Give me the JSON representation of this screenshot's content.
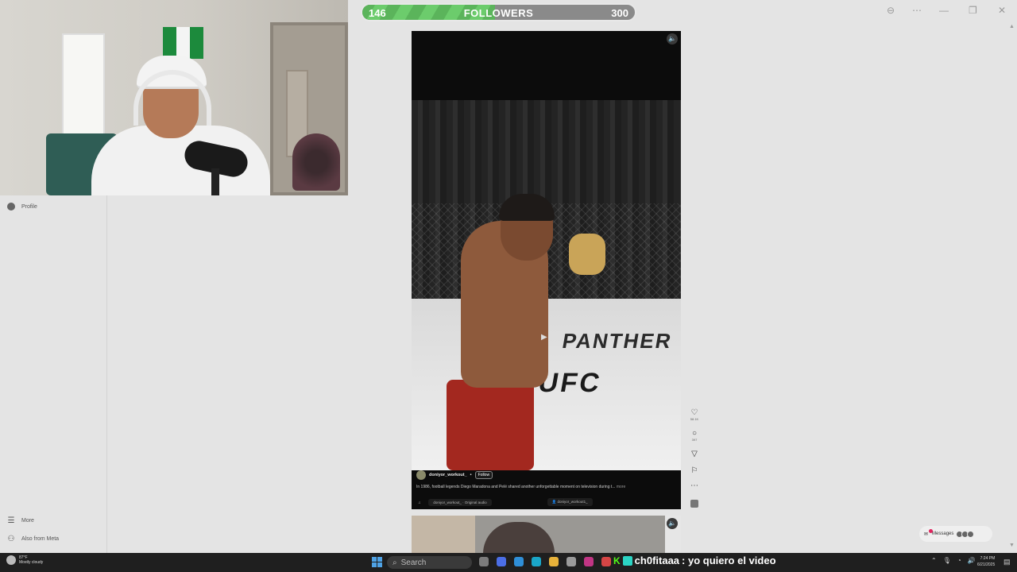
{
  "followers": {
    "current": "146",
    "label": "FOLLOWERS",
    "goal": "300",
    "progress_fraction": 0.487,
    "bar_color": "#5bb45b"
  },
  "sidebar": {
    "profile_label": "Profile",
    "more_label": "More",
    "also_from_meta_label": "Also from Meta"
  },
  "reel": {
    "author": "doniyor_workout_",
    "author_dot": "•",
    "follow_label": "Follow",
    "caption": "In 1986, football legends Diego Maradona and Pelé shared another unforgettable moment on television during t...",
    "more_label": "more",
    "audio_label": "doniyor_workout_ · Original audio",
    "tagged_user": "doniyor_workout1_",
    "sponsor_text": "PANTHER",
    "logo_text": "UFC",
    "like_count": "58.1K",
    "comment_count": "397"
  },
  "messages": {
    "label": "Messages",
    "badge_color": "#e0245e"
  },
  "taskbar": {
    "weather_temp": "87°F",
    "weather_desc": "Mostly cloudy",
    "search_placeholder": "Search",
    "chat_user": "ch0fitaaa",
    "chat_text": ": yo quiero el video",
    "time": "7:24 PM",
    "date": "6/21/2025"
  },
  "icons": [
    "zoom-out-icon",
    "more-icon",
    "minimize-icon",
    "restore-icon",
    "close-icon",
    "heart-icon",
    "comment-icon",
    "share-icon",
    "bookmark-icon",
    "more-options-icon",
    "mute-icon",
    "menu-icon",
    "meta-icon",
    "windows-start-icon",
    "search-icon"
  ]
}
